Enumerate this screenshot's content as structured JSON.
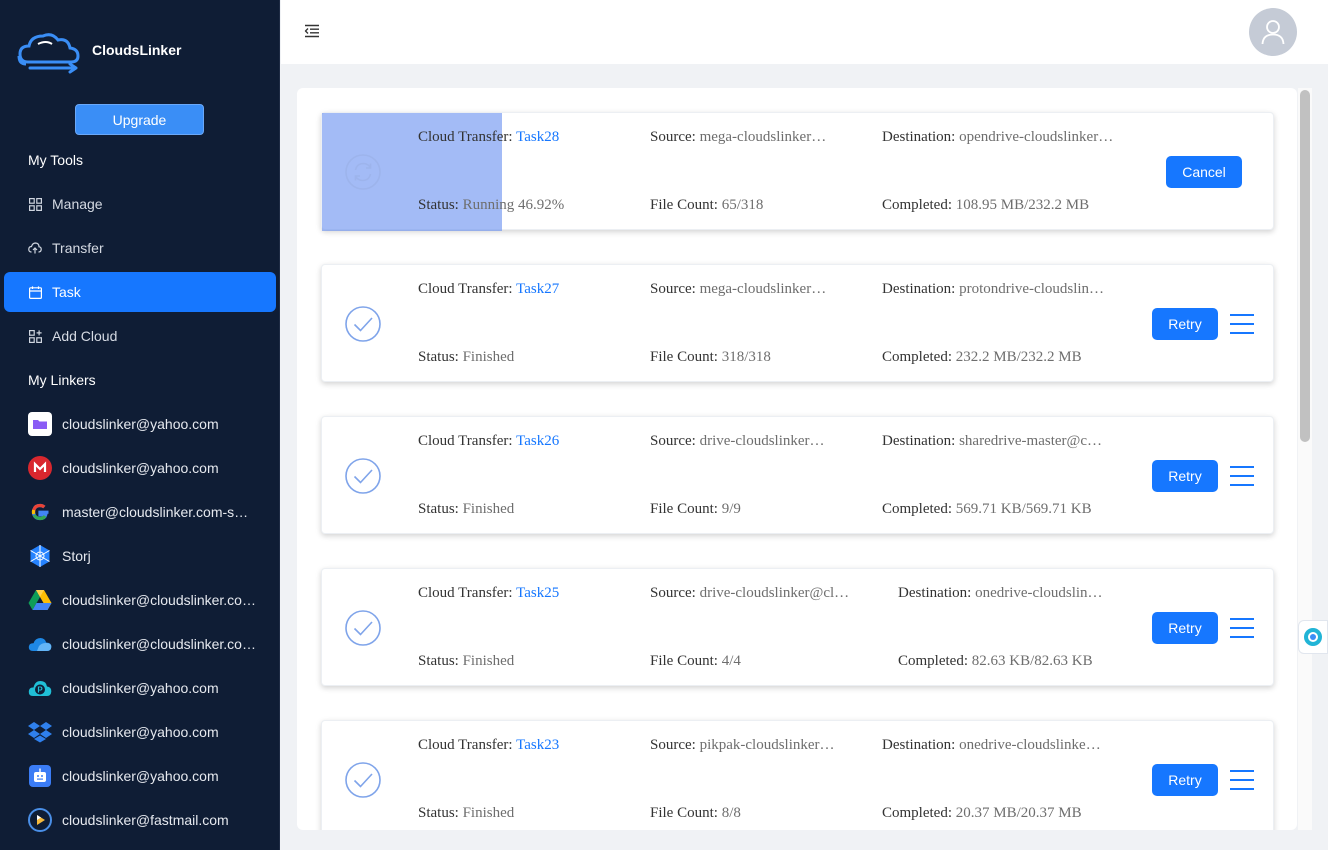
{
  "app": {
    "name": "CloudsLinker",
    "upgrade_label": "Upgrade"
  },
  "sidebar": {
    "tools_title": "My Tools",
    "tools": [
      {
        "label": "Manage",
        "icon": "grid-icon"
      },
      {
        "label": "Transfer",
        "icon": "cloud-upload-icon"
      },
      {
        "label": "Task",
        "icon": "calendar-icon",
        "active": true
      },
      {
        "label": "Add Cloud",
        "icon": "add-app-icon"
      }
    ],
    "linkers_title": "My Linkers",
    "linkers": [
      {
        "label": "cloudslinker@yahoo.com",
        "icon": "folder-purple-icon"
      },
      {
        "label": "cloudslinker@yahoo.com",
        "icon": "mega-icon"
      },
      {
        "label": "master@cloudslinker.com-s…",
        "icon": "google-icon"
      },
      {
        "label": "Storj",
        "icon": "storj-icon"
      },
      {
        "label": "cloudslinker@cloudslinker.co…",
        "icon": "google-drive-icon"
      },
      {
        "label": "cloudslinker@cloudslinker.co…",
        "icon": "onedrive-icon"
      },
      {
        "label": "cloudslinker@yahoo.com",
        "icon": "pcloud-icon"
      },
      {
        "label": "cloudslinker@yahoo.com",
        "icon": "dropbox-icon"
      },
      {
        "label": "cloudslinker@yahoo.com",
        "icon": "box-icon"
      },
      {
        "label": "cloudslinker@fastmail.com",
        "icon": "fastmail-icon"
      }
    ]
  },
  "labels": {
    "cloud_transfer": "Cloud Transfer:",
    "source": "Source:",
    "destination": "Destination:",
    "status": "Status:",
    "file_count": "File Count:",
    "completed": "Completed:"
  },
  "tasks": [
    {
      "name": "Task28",
      "source": "mega-cloudslinker…",
      "destination": "opendrive-cloudslinker…",
      "status": "Running 46.92%",
      "file_count": "65/318",
      "completed": "108.95 MB/232.2 MB",
      "action": "Cancel"
    },
    {
      "name": "Task27",
      "source": "mega-cloudslinker…",
      "destination": "protondrive-cloudslin…",
      "status": "Finished",
      "file_count": "318/318",
      "completed": "232.2 MB/232.2 MB",
      "action": "Retry"
    },
    {
      "name": "Task26",
      "source": "drive-cloudslinker…",
      "destination": "sharedrive-master@c…",
      "status": "Finished",
      "file_count": "9/9",
      "completed": "569.71 KB/569.71 KB",
      "action": "Retry"
    },
    {
      "name": "Task25",
      "source": "drive-cloudslinker@cl…",
      "destination": "onedrive-cloudslin…",
      "status": "Finished",
      "file_count": "4/4",
      "completed": "82.63 KB/82.63 KB",
      "action": "Retry"
    },
    {
      "name": "Task23",
      "source": "pikpak-cloudslinker…",
      "destination": "onedrive-cloudslinke…",
      "status": "Finished",
      "file_count": "8/8",
      "completed": "20.37 MB/20.37 MB",
      "action": "Retry"
    }
  ],
  "colors": {
    "sidebar_bg": "#0f1d35",
    "accent": "#1677ff"
  }
}
